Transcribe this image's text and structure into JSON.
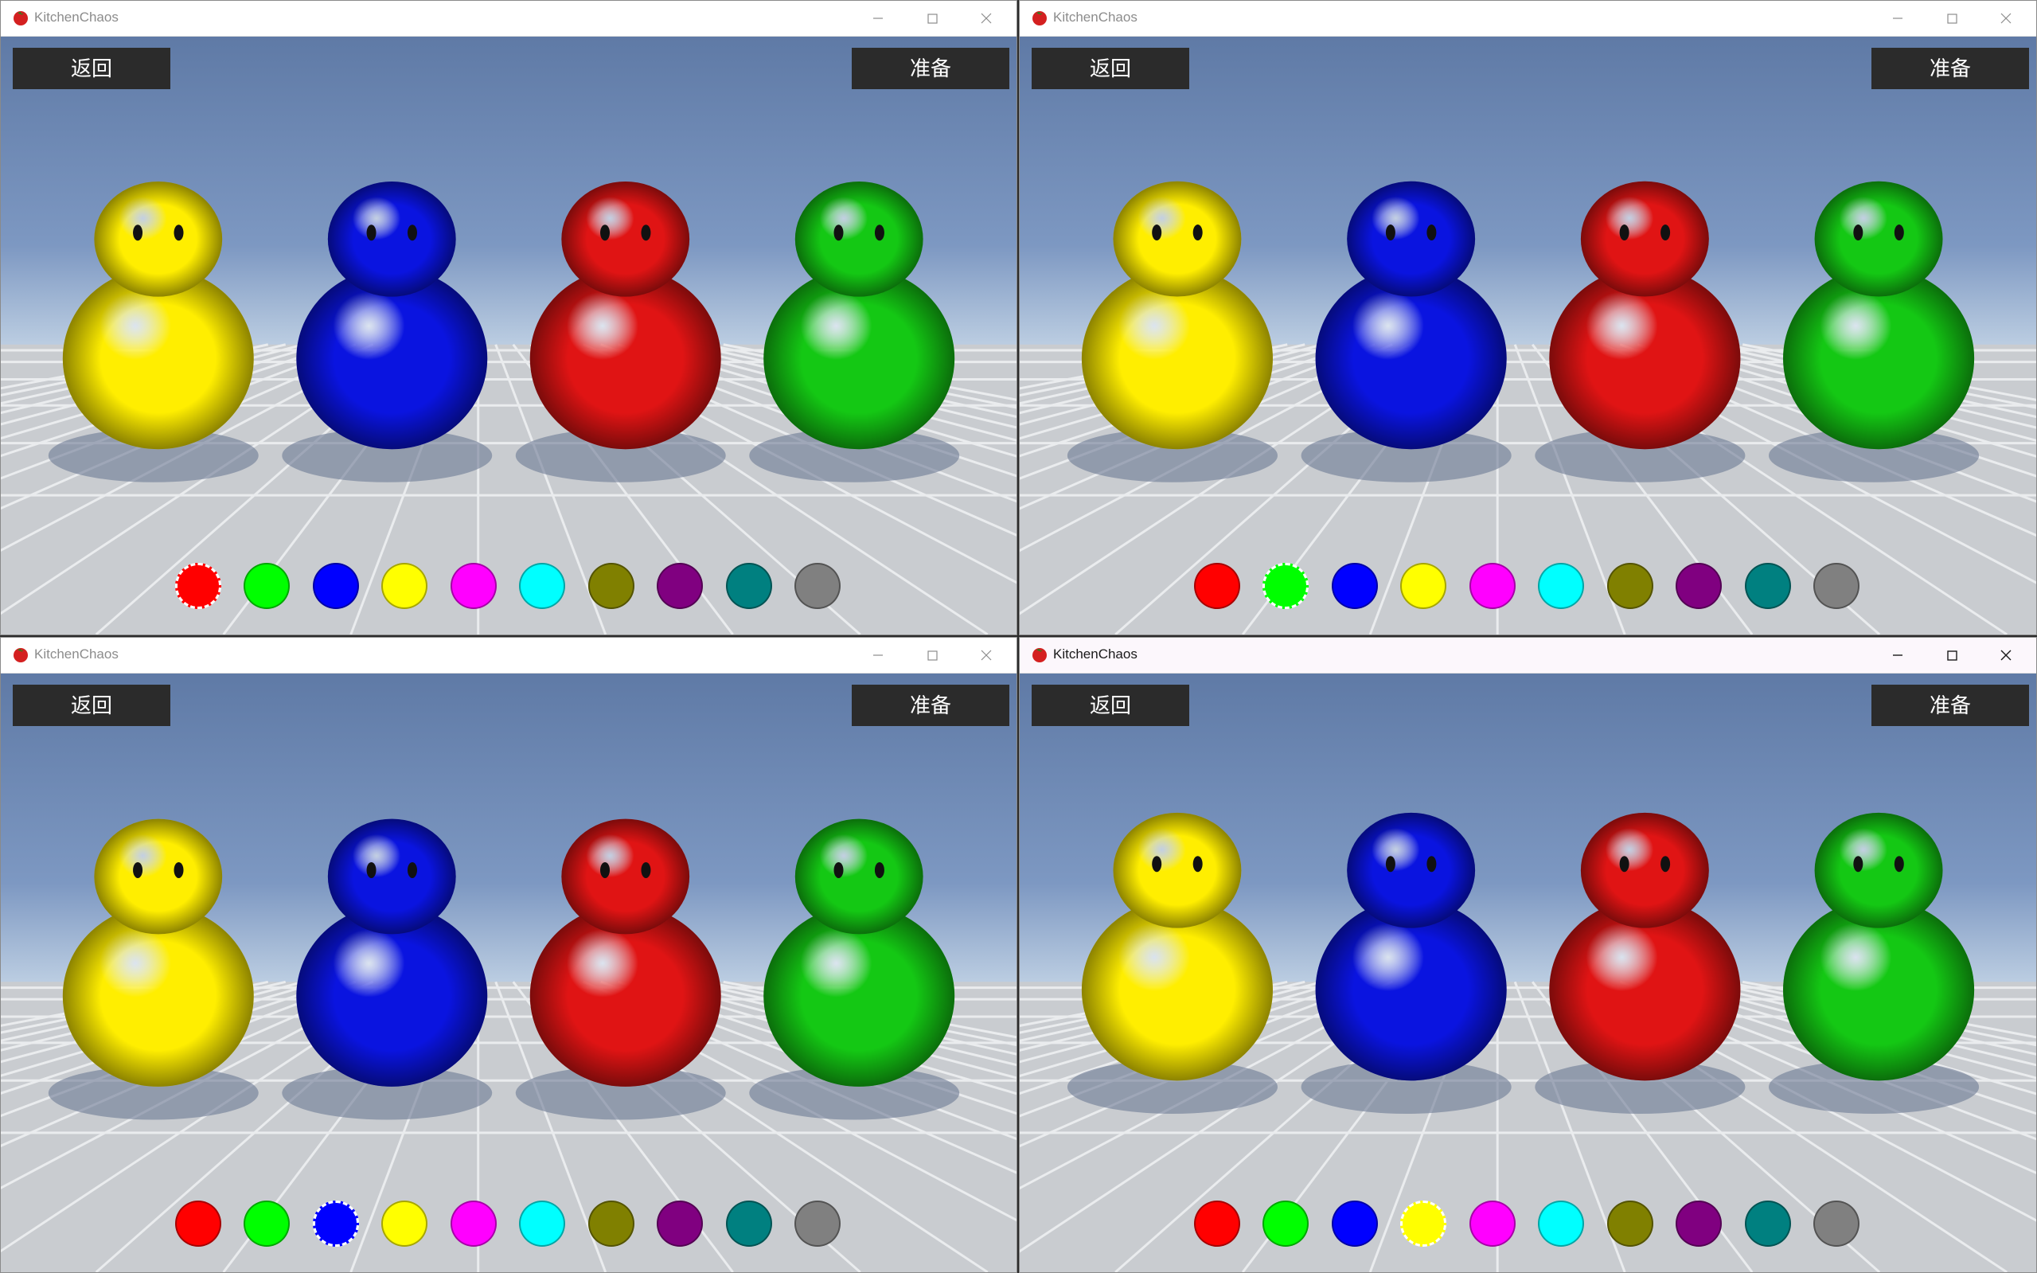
{
  "app": {
    "title": "KitchenChaos"
  },
  "buttons": {
    "back": "返回",
    "ready": "准备"
  },
  "colors": {
    "palette": [
      "#ff0000",
      "#00ff00",
      "#0000ff",
      "#ffff00",
      "#ff00ff",
      "#00ffff",
      "#808000",
      "#800080",
      "#008080",
      "#808080"
    ],
    "player_colors": [
      "#ffee00",
      "#0a14e0",
      "#e01414",
      "#14c814"
    ]
  },
  "windows": [
    {
      "selected_color_index": 0,
      "focused": false
    },
    {
      "selected_color_index": 1,
      "focused": false
    },
    {
      "selected_color_index": 2,
      "focused": false
    },
    {
      "selected_color_index": 3,
      "focused": true
    }
  ],
  "icons": {
    "app": "tomato-icon",
    "minimize": "minimize-icon",
    "maximize": "maximize-icon",
    "close": "close-icon"
  }
}
